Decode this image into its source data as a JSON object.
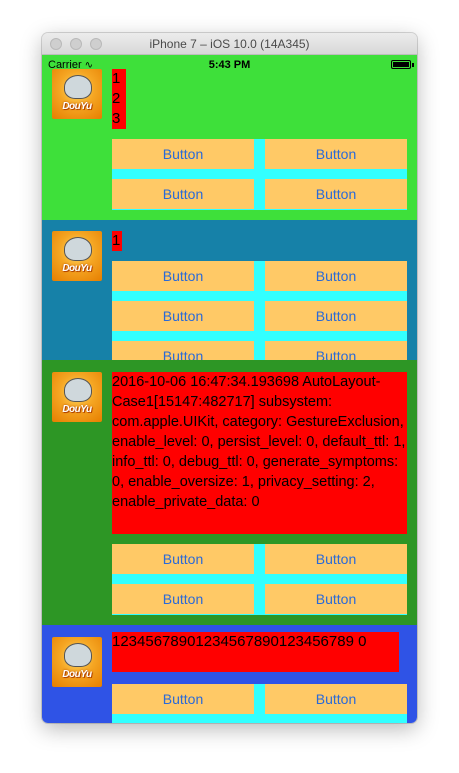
{
  "window": {
    "title": "iPhone 7 – iOS 10.0 (14A345)"
  },
  "status_bar": {
    "carrier": "Carrier",
    "time": "5:43 PM",
    "wifi_icon": "wifi-icon",
    "battery_level": 1.0
  },
  "colors": {
    "cell1_bg": "#3ee03a",
    "cell2_bg": "#1681a8",
    "cell3_bg": "#2d9625",
    "cell4_bg": "#2f53e6",
    "label_bg": "#ff0000",
    "button_bg": "#ffc966",
    "button_text": "#2a6ad8",
    "button_area_bg": "#33ffff"
  },
  "avatar": {
    "logo_text": "DouYu"
  },
  "cells": [
    {
      "label": "1\n2\n3",
      "buttons": [
        "Button",
        "Button",
        "Button",
        "Button"
      ]
    },
    {
      "label": "1",
      "buttons": [
        "Button",
        "Button",
        "Button",
        "Button",
        "Button",
        "Button"
      ]
    },
    {
      "label": "2016-10-06 16:47:34.193698 AutoLayout-Case1[15147:482717] subsystem: com.apple.UIKit, category: GestureExclusion, enable_level: 0, persist_level: 0, default_ttl: 1, info_ttl: 0, debug_ttl: 0, generate_symptoms: 0, enable_oversize: 1, privacy_setting: 2, enable_private_data: 0",
      "buttons": [
        "Button",
        "Button",
        "Button",
        "Button"
      ]
    },
    {
      "label": "12345678901234567890123456789 0",
      "buttons": [
        "Button",
        "Button"
      ]
    }
  ]
}
